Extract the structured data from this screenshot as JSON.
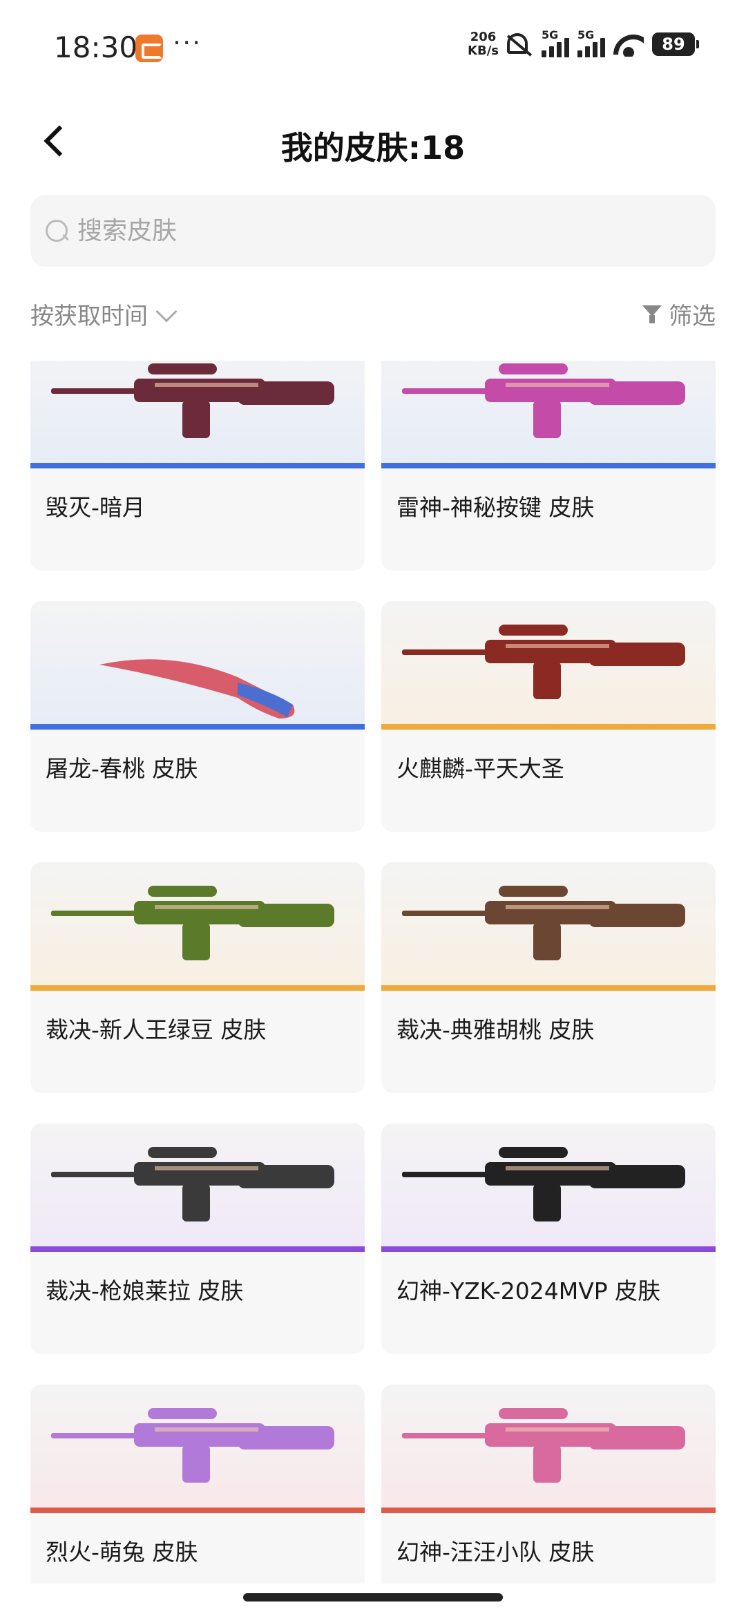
{
  "status_bar": {
    "time": "18:30",
    "dots": "···",
    "net_speed_value": "206",
    "net_speed_unit": "KB/s",
    "sim1_label": "5G",
    "sim2_label": "5G",
    "battery": "89"
  },
  "header": {
    "title": "我的皮肤:18"
  },
  "search": {
    "placeholder": "搜索皮肤"
  },
  "toolbar": {
    "sort_label": "按获取时间",
    "filter_label": "筛选"
  },
  "skins": [
    {
      "name": "毁灭-暗月",
      "tier_color": "#3f6fe0",
      "bg": "#e6ecf7",
      "weapon_color": "#6b2b3a"
    },
    {
      "name": "雷神-神秘按键 皮肤",
      "tier_color": "#3f6fe0",
      "bg": "#e6ecf7",
      "weapon_color": "#c44ba8"
    },
    {
      "name": "屠龙-春桃 皮肤",
      "tier_color": "#3f6fe0",
      "bg": "#e6ecf7",
      "weapon_color": "#d85c6a"
    },
    {
      "name": "火麒麟-平天大圣",
      "tier_color": "#f0a93a",
      "bg": "#f8efe2",
      "weapon_color": "#8a2a22"
    },
    {
      "name": "裁决-新人王绿豆 皮肤",
      "tier_color": "#f0a93a",
      "bg": "#f8efe2",
      "weapon_color": "#5b7a2a"
    },
    {
      "name": "裁决-典雅胡桃 皮肤",
      "tier_color": "#f0a93a",
      "bg": "#f8efe2",
      "weapon_color": "#6b4632"
    },
    {
      "name": "裁决-枪娘莱拉 皮肤",
      "tier_color": "#8b4bd8",
      "bg": "#f0e8f8",
      "weapon_color": "#3a3a3a"
    },
    {
      "name": "幻神-YZK-2024MVP 皮肤",
      "tier_color": "#8b4bd8",
      "bg": "#f0e8f8",
      "weapon_color": "#222222"
    },
    {
      "name": "烈火-萌兔 皮肤",
      "tier_color": "#e05a4a",
      "bg": "#f8e8ea",
      "weapon_color": "#b27ad8"
    },
    {
      "name": "幻神-汪汪小队 皮肤",
      "tier_color": "#e05a4a",
      "bg": "#f8e8ea",
      "weapon_color": "#d86aa0"
    }
  ]
}
